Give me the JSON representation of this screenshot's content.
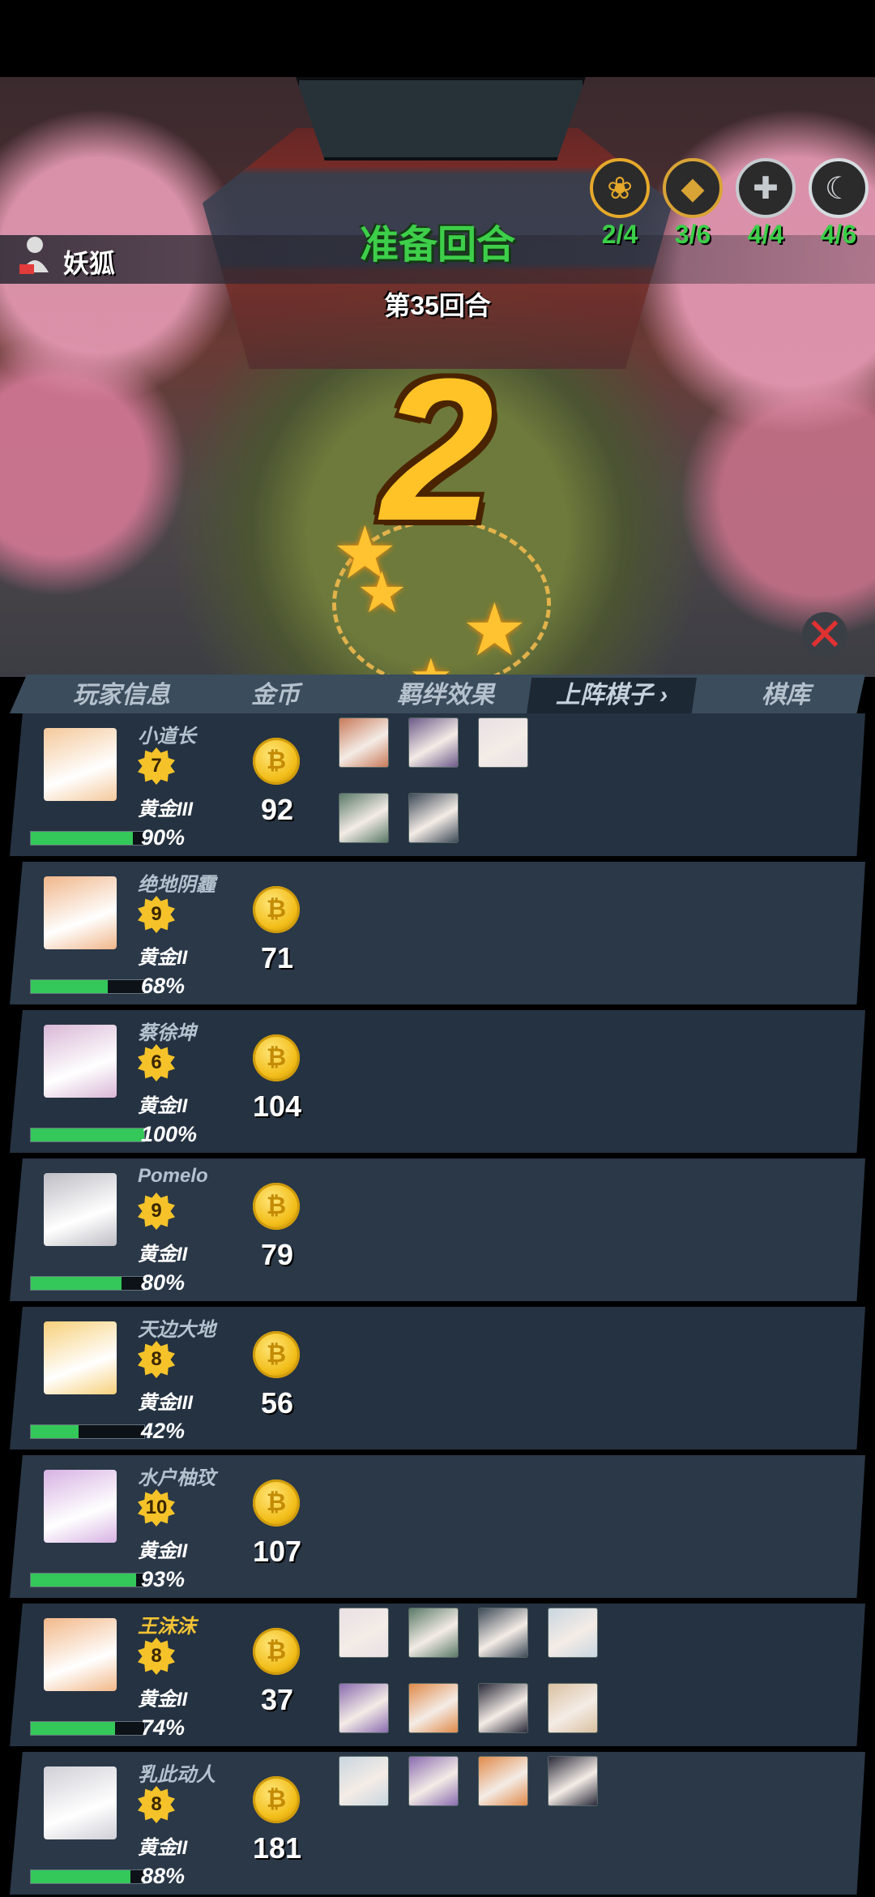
{
  "player": {
    "name": "妖狐"
  },
  "phase": {
    "title": "准备回合",
    "round": "第35回合",
    "countdown": "2"
  },
  "synergies": [
    {
      "icon": "lotus-icon",
      "symbol": "❀",
      "count": "2/4",
      "color": "#e6a92b"
    },
    {
      "icon": "gem-icon",
      "symbol": "◆",
      "count": "3/6",
      "color": "#d9a436"
    },
    {
      "icon": "cross-icon",
      "symbol": "✚",
      "count": "4/4",
      "color": "#c6cbd0"
    },
    {
      "icon": "moon-icon",
      "symbol": "☾",
      "count": "4/6",
      "color": "#d7dce0"
    }
  ],
  "tabs": [
    "玩家信息",
    "金币",
    "羁绊效果",
    "上阵棋子",
    "棋库"
  ],
  "active_tab_arrow": "›",
  "players": [
    {
      "name": "小道长",
      "level": "7",
      "rank": "黄金III",
      "hp": "90%",
      "hp_value": 0.9,
      "gold": "92",
      "champions": 5,
      "highlight": false
    },
    {
      "name": "绝地阴霾",
      "level": "9",
      "rank": "黄金II",
      "hp": "68%",
      "hp_value": 0.68,
      "gold": "71",
      "champions": 0,
      "highlight": false
    },
    {
      "name": "蔡徐坤",
      "level": "6",
      "rank": "黄金II",
      "hp": "100%",
      "hp_value": 1.0,
      "gold": "104",
      "champions": 0,
      "highlight": false
    },
    {
      "name": "Pomelo",
      "level": "9",
      "rank": "黄金II",
      "hp": "80%",
      "hp_value": 0.8,
      "gold": "79",
      "champions": 0,
      "highlight": false
    },
    {
      "name": "天边大地",
      "level": "8",
      "rank": "黄金III",
      "hp": "42%",
      "hp_value": 0.42,
      "gold": "56",
      "champions": 0,
      "highlight": false
    },
    {
      "name": "水户柚玟",
      "level": "10",
      "rank": "黄金II",
      "hp": "93%",
      "hp_value": 0.93,
      "gold": "107",
      "champions": 0,
      "highlight": false
    },
    {
      "name": "王沫沫",
      "level": "8",
      "rank": "黄金II",
      "hp": "74%",
      "hp_value": 0.74,
      "gold": "37",
      "champions": 8,
      "highlight": true
    },
    {
      "name": "乳此动人",
      "level": "8",
      "rank": "黄金II",
      "hp": "88%",
      "hp_value": 0.88,
      "gold": "181",
      "champions": 4,
      "highlight": false
    }
  ],
  "close_symbol": "✕",
  "coin_symbol": "₿"
}
